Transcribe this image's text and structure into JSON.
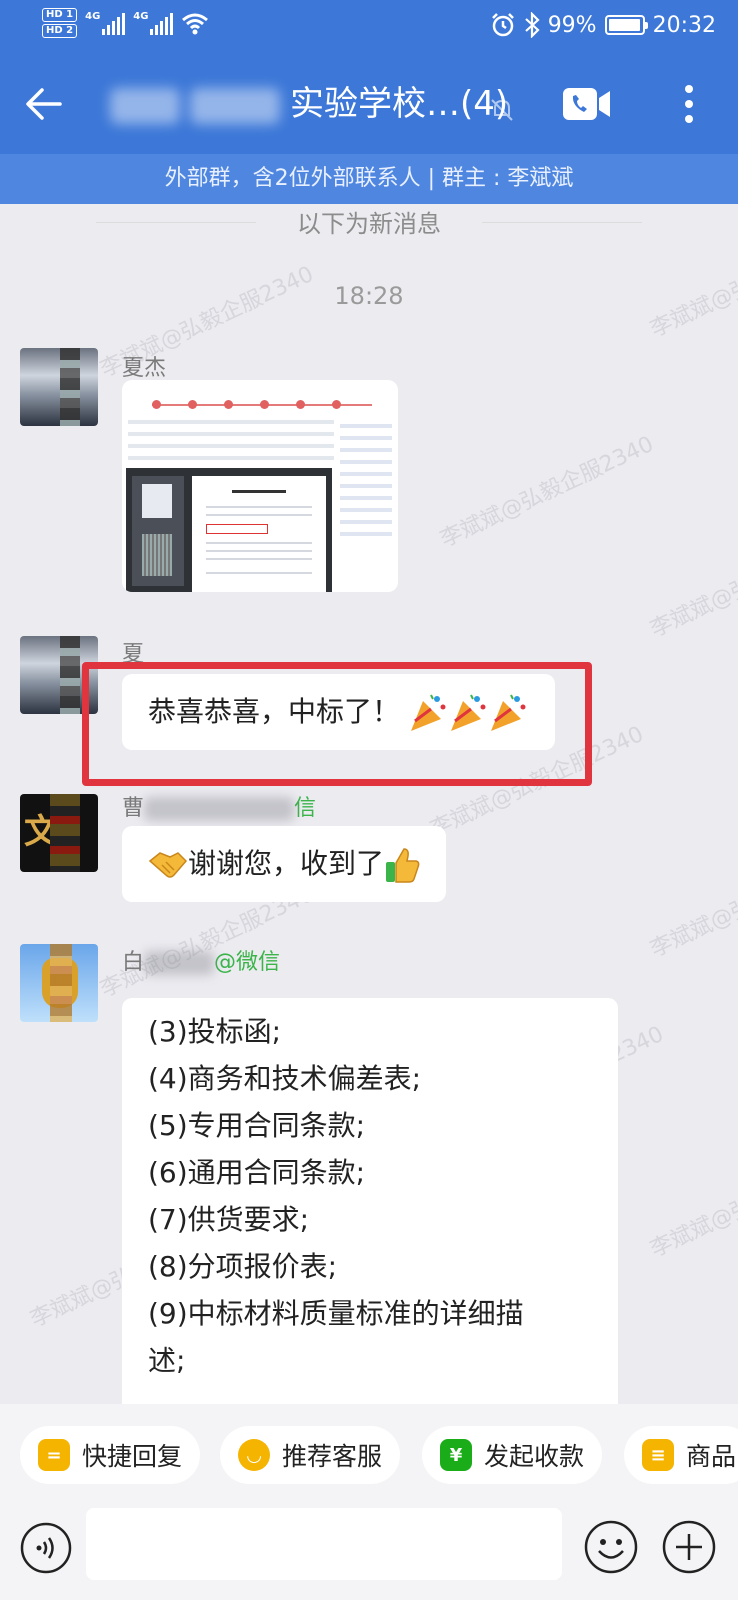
{
  "status_bar": {
    "sim1": "HD 1",
    "sim2": "HD 2",
    "net1": "4G",
    "net2": "4G",
    "battery": "99%",
    "time": "20:32"
  },
  "header": {
    "title_visible": "实验学校…(4)",
    "subtitle": "外部群，含2位外部联系人 | 群主 : 李斌斌"
  },
  "chat": {
    "divider": "以下为新消息",
    "time": "18:28",
    "watermark": "李斌斌@弘毅企服2340",
    "messages": [
      {
        "sender": "夏杰",
        "kind": "image"
      },
      {
        "sender": "夏",
        "kind": "text",
        "text": "恭喜恭喜，中标了！",
        "emoji": "party-popper x3"
      },
      {
        "sender_prefix": "曹",
        "sender_suffix": "信",
        "kind": "text",
        "text": "谢谢您，收到了",
        "emoji_before": "handshake",
        "emoji_after": "thumbs-up"
      },
      {
        "sender_prefix": "白",
        "sender_suffix": "@微信",
        "kind": "list",
        "lines": [
          "(3)投标函;",
          "(4)商务和技术偏差表;",
          "(5)专用合同条款;",
          "(6)通用合同条款;",
          "(7)供货要求;",
          "(8)分项报价表;",
          "(9)中标材料质量标准的详细描",
          "述;"
        ]
      }
    ]
  },
  "quick_actions": [
    {
      "label": "快捷回复",
      "color": "#f4b400",
      "icon": "="
    },
    {
      "label": "推荐客服",
      "color": "#f4b400",
      "icon": "◡"
    },
    {
      "label": "发起收款",
      "color": "#1aad19",
      "icon": "¥"
    },
    {
      "label": "商品",
      "color": "#f4b400",
      "icon": "≡"
    }
  ],
  "input": {
    "placeholder": ""
  }
}
